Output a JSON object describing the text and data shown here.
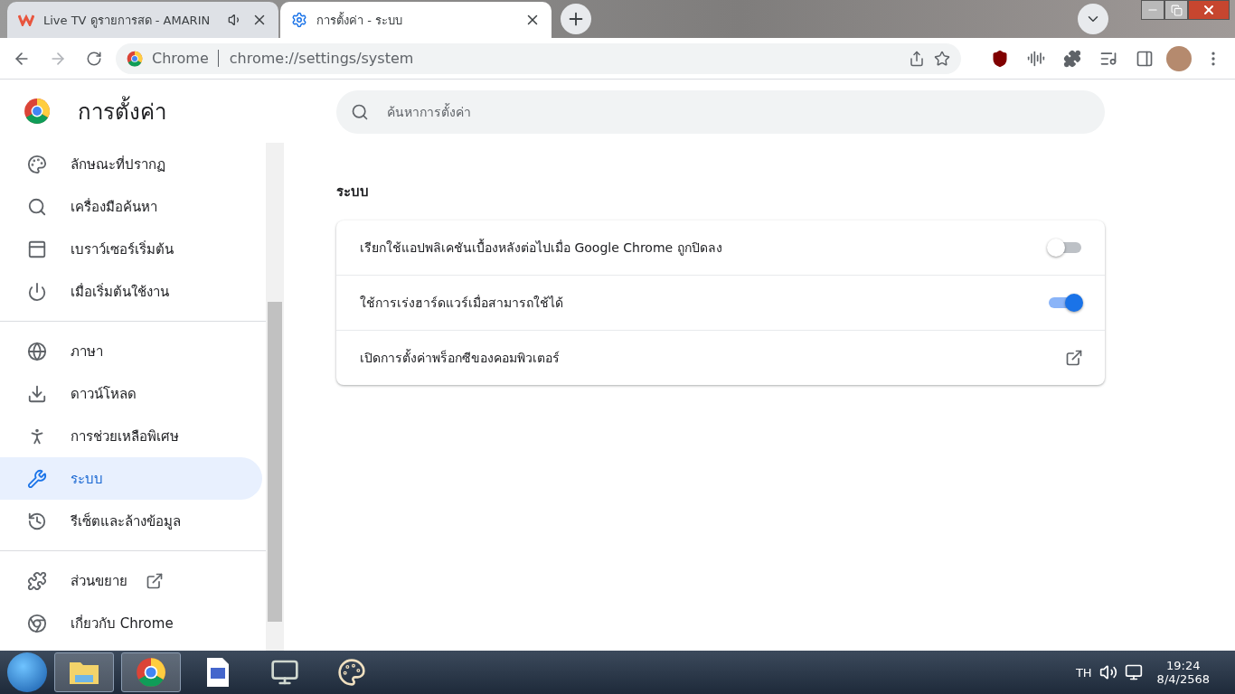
{
  "tabs": [
    {
      "title": "Live TV ดูรายการสด - AMARIN",
      "selected": false,
      "audio": true
    },
    {
      "title": "การตั้งค่า - ระบบ",
      "selected": true,
      "audio": false
    }
  ],
  "address": {
    "site": "Chrome",
    "url": "chrome://settings/system"
  },
  "sidebar": {
    "title": "การตั้งค่า",
    "groups": [
      [
        {
          "label": "ลักษณะที่ปรากฏ",
          "selected": false
        },
        {
          "label": "เครื่องมือค้นหา",
          "selected": false
        },
        {
          "label": "เบราว์เซอร์เริ่มต้น",
          "selected": false
        },
        {
          "label": "เมื่อเริ่มต้นใช้งาน",
          "selected": false
        }
      ],
      [
        {
          "label": "ภาษา",
          "selected": false
        },
        {
          "label": "ดาวน์โหลด",
          "selected": false
        },
        {
          "label": "การช่วยเหลือพิเศษ",
          "selected": false
        },
        {
          "label": "ระบบ",
          "selected": true
        },
        {
          "label": "รีเซ็ตและล้างข้อมูล",
          "selected": false
        }
      ],
      [
        {
          "label": "ส่วนขยาย",
          "selected": false,
          "external": true
        },
        {
          "label": "เกี่ยวกับ Chrome",
          "selected": false,
          "external": false
        }
      ]
    ]
  },
  "search": {
    "placeholder": "ค้นหาการตั้งค่า"
  },
  "section": {
    "title": "ระบบ",
    "rows": [
      {
        "kind": "toggle",
        "label": "เรียกใช้แอปพลิเคชันเบื้องหลังต่อไปเมื่อ Google Chrome ถูกปิดลง",
        "on": false
      },
      {
        "kind": "toggle",
        "label": "ใช้การเร่งฮาร์ดแวร์เมื่อสามารถใช้ได้",
        "on": true
      },
      {
        "kind": "link",
        "label": "เปิดการตั้งค่าพร็อกซีของคอมพิวเตอร์"
      }
    ]
  },
  "taskbar": {
    "language": "TH",
    "time": "19:24",
    "date": "8/4/2568"
  }
}
